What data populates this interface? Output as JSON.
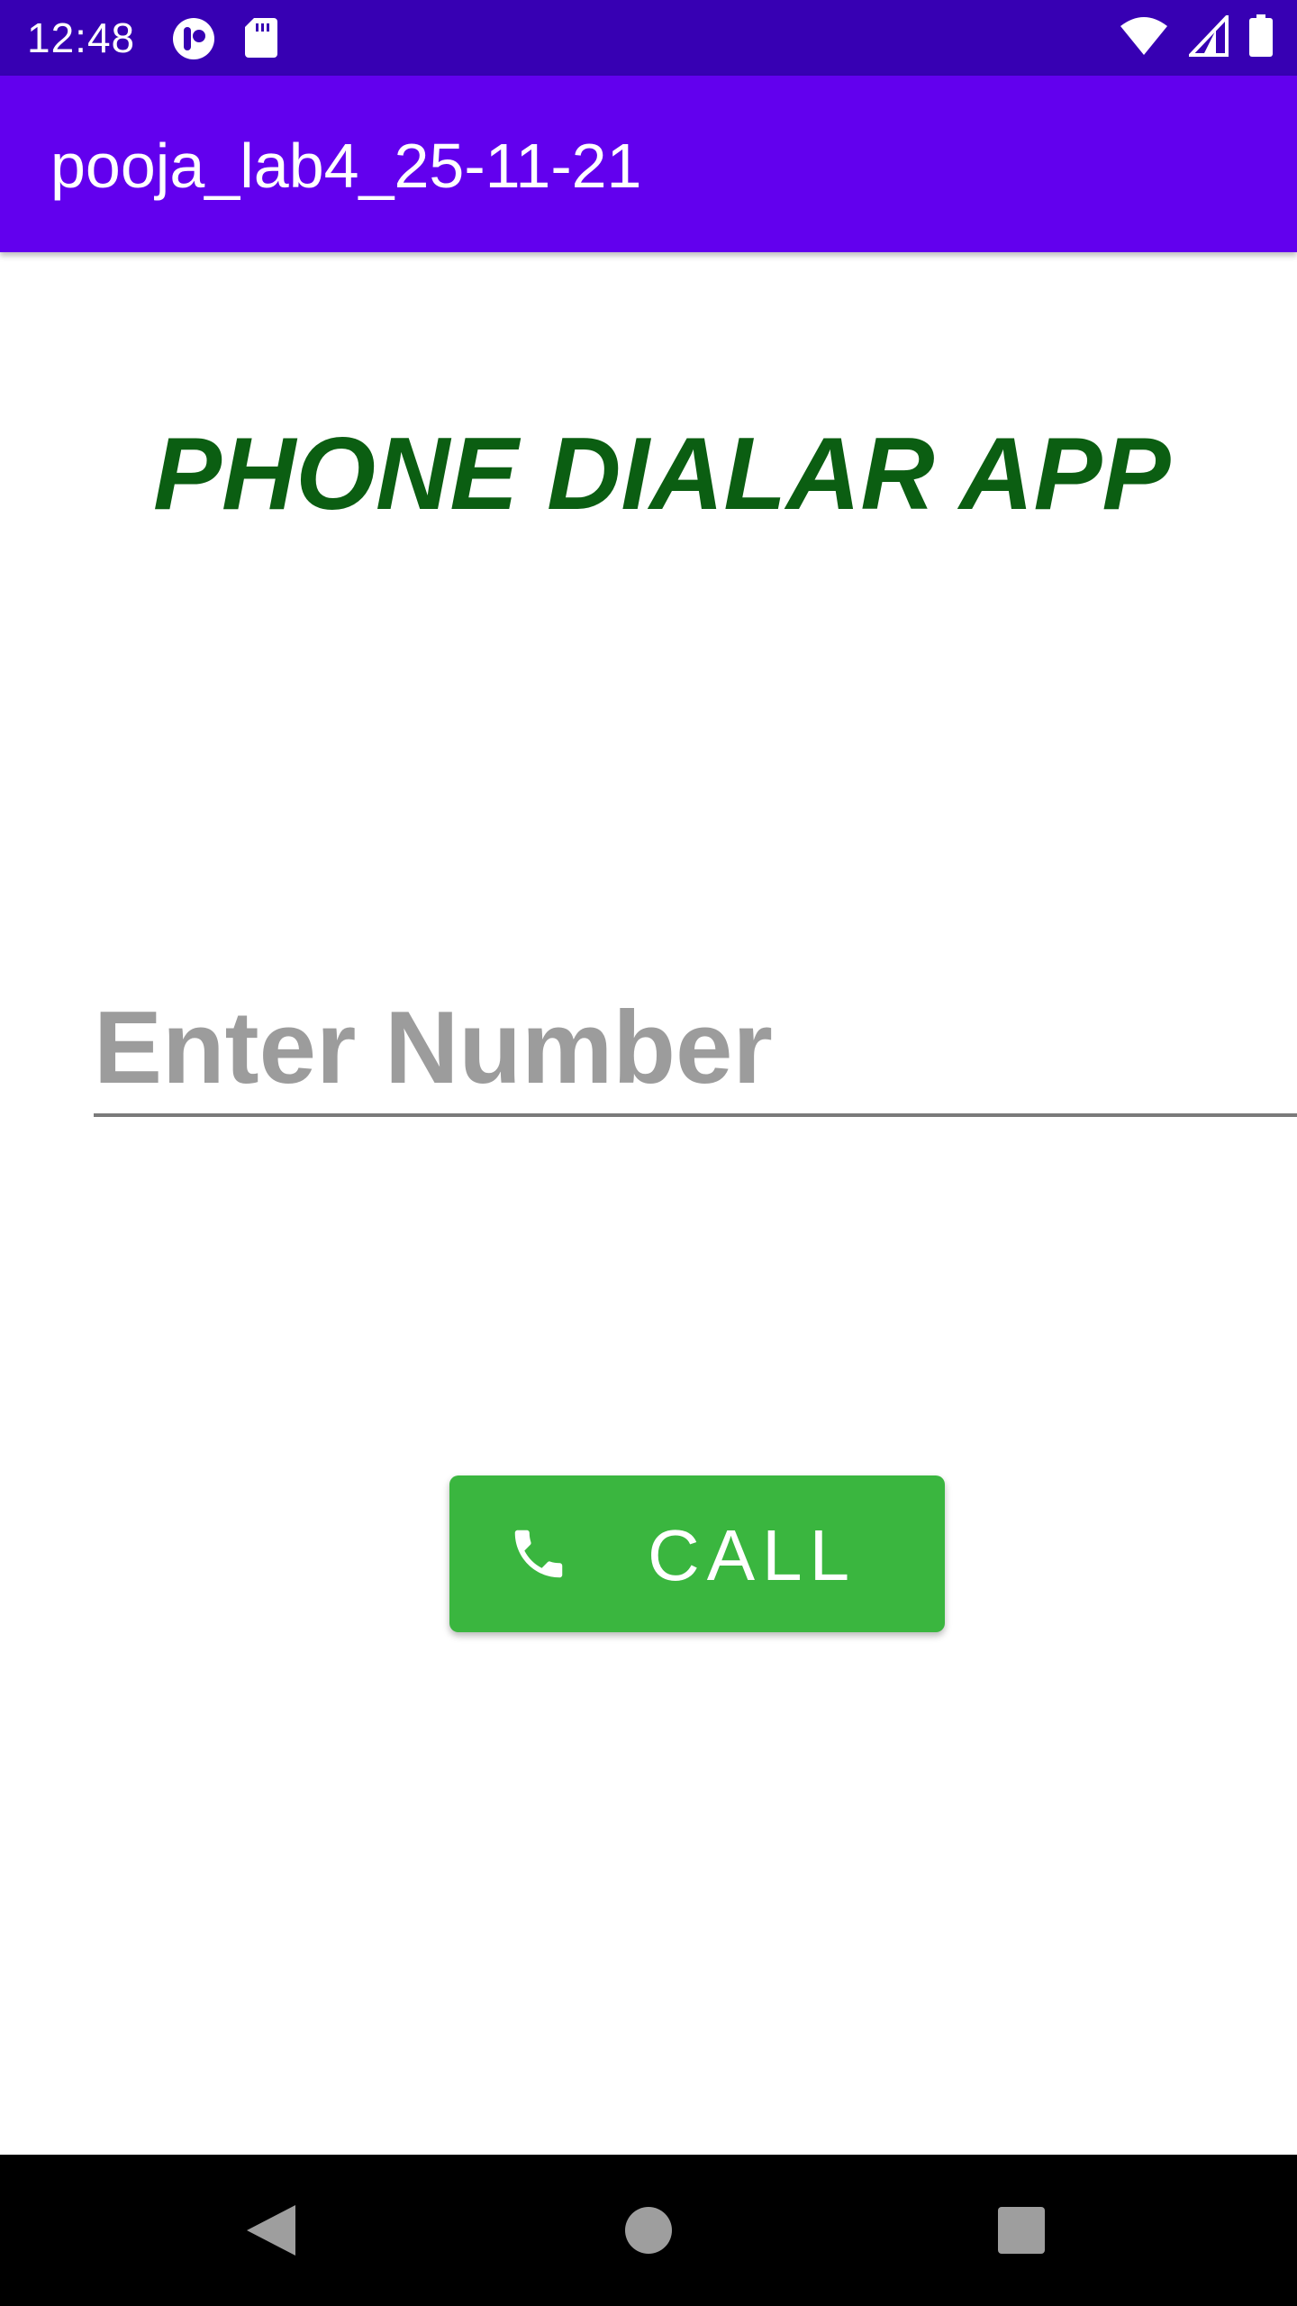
{
  "status_bar": {
    "time": "12:48",
    "icons": [
      "app-notification-icon",
      "sd-card-icon",
      "wifi-icon",
      "cell-signal-icon",
      "battery-icon"
    ],
    "background": "#3700b3"
  },
  "app_bar": {
    "title": "pooja_lab4_25-11-21",
    "background": "#6200ee"
  },
  "main": {
    "heading": "PHONE DIALAR APP",
    "heading_color": "#0b5e12",
    "number_input": {
      "value": "",
      "placeholder": "Enter Number"
    },
    "call_button": {
      "label": "CALL",
      "icon": "phone-icon",
      "background": "#3ab63f"
    }
  },
  "nav_bar": {
    "buttons": [
      "back-icon",
      "home-icon",
      "recents-icon"
    ]
  }
}
